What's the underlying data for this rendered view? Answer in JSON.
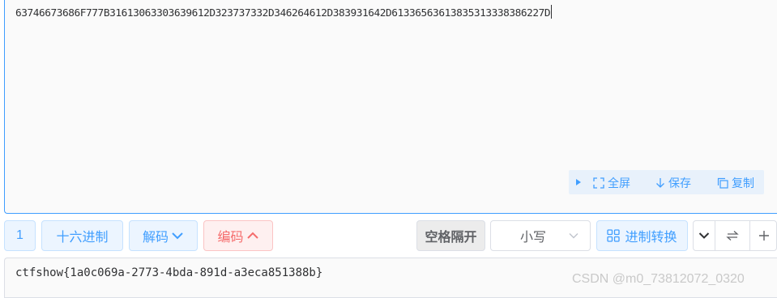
{
  "input": {
    "text": "63746673686F777B31613063303639612D323737332D346264612D383931642D61336563613835313338386227D"
  },
  "mini_toolbar": {
    "fullscreen_label": "全屏",
    "save_label": "保存",
    "copy_label": "复制"
  },
  "toolbar": {
    "count": "1",
    "mode_label": "十六进制",
    "decode_label": "解码",
    "encode_label": "编码",
    "space_separate_label": "空格隔开",
    "case_select_value": "小写",
    "convert_label": "进制转换"
  },
  "output": {
    "text": "ctfshow{1a0c069a-2773-4bda-891d-a3eca851388b}"
  },
  "watermark": "CSDN @m0_73812072_0320",
  "colors": {
    "primary": "#409eff",
    "danger": "#f56c6c",
    "text": "#303133"
  }
}
